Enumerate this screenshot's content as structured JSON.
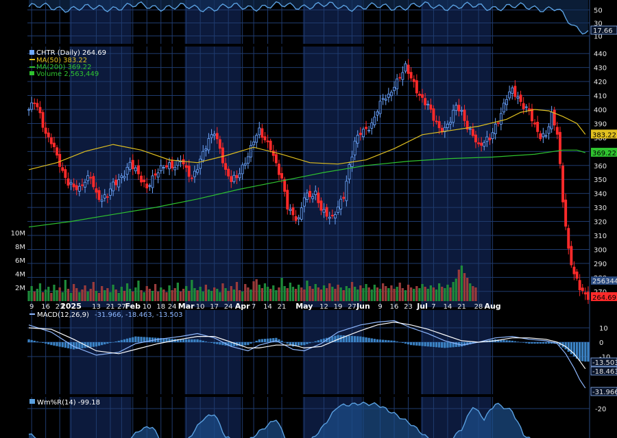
{
  "chart_data": {
    "type": "candlestick",
    "symbol": "CHTR",
    "timeframe": "Daily",
    "colors": {
      "up": "#6fa8ff",
      "down": "#ff2a2a",
      "ma50": "#e0c020",
      "ma200": "#2fc32f",
      "vol_up": "#1e8a3a",
      "vol_down": "#9a3b3b",
      "macd": "#8fb8ff",
      "signal": "#ffffff",
      "hist": "#3b82c4",
      "willr": "#5aa0e0",
      "grid": "#1f3b6e",
      "band": "#0c1a3c"
    },
    "legend": {
      "price": "CHTR (Daily) 264.69",
      "ma50": "MA(50) 383.22",
      "ma200": "MA(200) 369.22",
      "volume": "Volume 2,563,449",
      "macd_label": "MACD(12,26,9)",
      "macd_values": "-31.966, -18.463, -13.503",
      "willr": "Wm%R(14) -99.18"
    },
    "price_axis": {
      "ticks": [
        "440",
        "430",
        "420",
        "410",
        "400",
        "390",
        "380",
        "370",
        "360",
        "350",
        "340",
        "330",
        "320",
        "310",
        "300",
        "290",
        "280",
        "270"
      ],
      "ylim": [
        265,
        445
      ],
      "tags": [
        {
          "text": "383.22",
          "value": 382.2,
          "color": "#e0c020"
        },
        {
          "text": "369.22",
          "value": 369.2,
          "color": "#2fc32f"
        },
        {
          "text": "264.69",
          "value": 266.0,
          "color": "#ff2a2a"
        }
      ]
    },
    "volume_axis": {
      "ticks": [
        "10M",
        "8M",
        "6M",
        "4M",
        "2M"
      ],
      "tag": "2563449",
      "ylim": [
        0,
        11
      ]
    },
    "macd_axis": {
      "ticks": [
        "10",
        "0",
        "-10"
      ],
      "tags": [
        "-13.503",
        "-18.463",
        "-31.966"
      ],
      "ylim": [
        -36,
        18
      ]
    },
    "top_axis": {
      "ticks": [
        "50",
        "30",
        "10"
      ],
      "tag": "17.66"
    },
    "willr_axis": {
      "ticks": [
        "-20"
      ]
    },
    "x_labels": [
      {
        "text": "9",
        "i": 1
      },
      {
        "text": "16",
        "i": 6
      },
      {
        "text": "23",
        "i": 11
      },
      {
        "text": "2025",
        "i": 15,
        "bold": true
      },
      {
        "text": "13",
        "i": 24
      },
      {
        "text": "21",
        "i": 29
      },
      {
        "text": "27",
        "i": 33
      },
      {
        "text": "Feb",
        "i": 37,
        "bold": true
      },
      {
        "text": "10",
        "i": 42
      },
      {
        "text": "18",
        "i": 47
      },
      {
        "text": "24",
        "i": 51
      },
      {
        "text": "Mar",
        "i": 56,
        "bold": true
      },
      {
        "text": "10",
        "i": 61
      },
      {
        "text": "17",
        "i": 66
      },
      {
        "text": "24",
        "i": 71
      },
      {
        "text": "Apr",
        "i": 76,
        "bold": true
      },
      {
        "text": "7",
        "i": 80
      },
      {
        "text": "14",
        "i": 85
      },
      {
        "text": "21",
        "i": 90
      },
      {
        "text": "May",
        "i": 98,
        "bold": true
      },
      {
        "text": "12",
        "i": 105
      },
      {
        "text": "19",
        "i": 110
      },
      {
        "text": "27",
        "i": 115
      },
      {
        "text": "Jun",
        "i": 119,
        "bold": true
      },
      {
        "text": "9",
        "i": 125
      },
      {
        "text": "16",
        "i": 130
      },
      {
        "text": "23",
        "i": 135
      },
      {
        "text": "Jul",
        "i": 140,
        "bold": true
      },
      {
        "text": "7",
        "i": 144
      },
      {
        "text": "14",
        "i": 149
      },
      {
        "text": "21",
        "i": 154
      },
      {
        "text": "28",
        "i": 160
      },
      {
        "text": "Aug",
        "i": 165,
        "bold": true
      }
    ],
    "price_points": [
      [
        0,
        400
      ],
      [
        2,
        405
      ],
      [
        4,
        396
      ],
      [
        6,
        383
      ],
      [
        8,
        378
      ],
      [
        10,
        366
      ],
      [
        12,
        354
      ],
      [
        14,
        348
      ],
      [
        16,
        346
      ],
      [
        18,
        343
      ],
      [
        20,
        348
      ],
      [
        22,
        352
      ],
      [
        24,
        340
      ],
      [
        26,
        336
      ],
      [
        28,
        338
      ],
      [
        30,
        346
      ],
      [
        32,
        350
      ],
      [
        34,
        355
      ],
      [
        36,
        361
      ],
      [
        38,
        356
      ],
      [
        40,
        350
      ],
      [
        42,
        345
      ],
      [
        44,
        351
      ],
      [
        46,
        355
      ],
      [
        48,
        359
      ],
      [
        50,
        361
      ],
      [
        52,
        360
      ],
      [
        54,
        364
      ],
      [
        56,
        356
      ],
      [
        58,
        351
      ],
      [
        60,
        360
      ],
      [
        62,
        369
      ],
      [
        64,
        377
      ],
      [
        66,
        384
      ],
      [
        67,
        378
      ],
      [
        68,
        373
      ],
      [
        70,
        356
      ],
      [
        72,
        349
      ],
      [
        74,
        351
      ],
      [
        76,
        359
      ],
      [
        78,
        368
      ],
      [
        80,
        378
      ],
      [
        82,
        384
      ],
      [
        84,
        378
      ],
      [
        86,
        374
      ],
      [
        88,
        361
      ],
      [
        90,
        349
      ],
      [
        92,
        330
      ],
      [
        94,
        325
      ],
      [
        96,
        322
      ],
      [
        98,
        338
      ],
      [
        100,
        337
      ],
      [
        102,
        340
      ],
      [
        104,
        330
      ],
      [
        106,
        325
      ],
      [
        108,
        321
      ],
      [
        110,
        330
      ],
      [
        112,
        339
      ],
      [
        114,
        360
      ],
      [
        116,
        376
      ],
      [
        118,
        383
      ],
      [
        120,
        386
      ],
      [
        122,
        390
      ],
      [
        124,
        400
      ],
      [
        126,
        407
      ],
      [
        128,
        409
      ],
      [
        130,
        418
      ],
      [
        132,
        424
      ],
      [
        134,
        430
      ],
      [
        136,
        422
      ],
      [
        138,
        414
      ],
      [
        140,
        408
      ],
      [
        142,
        403
      ],
      [
        144,
        393
      ],
      [
        146,
        386
      ],
      [
        148,
        387
      ],
      [
        150,
        393
      ],
      [
        152,
        402
      ],
      [
        154,
        397
      ],
      [
        156,
        388
      ],
      [
        158,
        383
      ],
      [
        160,
        373
      ],
      [
        162,
        376
      ],
      [
        164,
        380
      ],
      [
        166,
        389
      ],
      [
        168,
        397
      ],
      [
        170,
        408
      ],
      [
        172,
        414
      ],
      [
        174,
        409
      ],
      [
        176,
        403
      ],
      [
        178,
        398
      ],
      [
        180,
        387
      ],
      [
        182,
        381
      ],
      [
        184,
        383
      ],
      [
        186,
        396
      ],
      [
        188,
        382
      ],
      [
        190,
        335
      ],
      [
        192,
        300
      ],
      [
        194,
        283
      ],
      [
        196,
        272
      ],
      [
        198,
        266
      ]
    ],
    "ma50": [
      [
        0,
        357
      ],
      [
        10,
        362
      ],
      [
        20,
        370
      ],
      [
        30,
        375
      ],
      [
        40,
        371
      ],
      [
        50,
        364
      ],
      [
        60,
        362
      ],
      [
        70,
        367
      ],
      [
        80,
        373
      ],
      [
        90,
        368
      ],
      [
        100,
        362
      ],
      [
        110,
        361
      ],
      [
        120,
        364
      ],
      [
        130,
        372
      ],
      [
        140,
        382
      ],
      [
        150,
        385
      ],
      [
        160,
        388
      ],
      [
        170,
        393
      ],
      [
        175,
        398
      ],
      [
        180,
        400
      ],
      [
        185,
        399
      ],
      [
        190,
        395
      ],
      [
        195,
        390
      ],
      [
        198,
        382.2
      ]
    ],
    "ma200": [
      [
        0,
        316
      ],
      [
        15,
        320
      ],
      [
        30,
        325
      ],
      [
        45,
        330
      ],
      [
        60,
        336
      ],
      [
        75,
        343
      ],
      [
        90,
        349
      ],
      [
        105,
        355
      ],
      [
        120,
        360
      ],
      [
        135,
        363
      ],
      [
        150,
        365
      ],
      [
        165,
        366
      ],
      [
        180,
        368
      ],
      [
        190,
        371
      ],
      [
        195,
        371
      ],
      [
        198,
        369.2
      ]
    ],
    "volume": [
      1.5,
      2.2,
      1.4,
      1.8,
      2.6,
      1.3,
      1.7,
      2.1,
      1.2,
      2.4,
      1.6,
      2.0,
      1.3,
      3.1,
      1.8,
      1.2,
      2.5,
      1.9,
      1.3,
      1.7,
      2.3,
      1.4,
      1.8,
      2.8,
      1.5,
      1.2,
      2.2,
      1.6,
      1.9,
      1.3,
      2.4,
      1.7,
      1.2,
      2.1,
      1.5,
      2.6,
      1.8,
      1.4,
      2.0,
      3.0,
      1.6,
      1.3,
      2.2,
      1.8,
      1.5,
      2.5,
      1.4,
      2.0,
      1.7,
      1.3,
      2.3,
      1.6,
      1.9,
      2.7,
      1.4,
      1.8,
      2.2,
      1.5,
      3.1,
      1.9,
      1.6,
      2.1,
      1.4,
      2.4,
      1.7,
      1.5,
      2.0,
      1.8,
      1.3,
      2.6,
      1.9,
      1.5,
      2.2,
      1.7,
      2.8,
      1.6,
      1.4,
      2.5,
      2.0,
      1.7,
      2.9,
      3.2,
      2.4,
      1.9,
      2.6,
      2.1,
      1.8,
      2.3,
      1.6,
      2.0,
      3.4,
      2.2,
      1.9,
      2.7,
      2.1,
      1.8,
      2.4,
      2.0,
      1.7,
      3.0,
      2.2,
      1.8,
      2.5,
      2.0,
      1.7,
      2.3,
      1.9,
      2.6,
      2.1,
      1.8,
      2.4,
      2.0,
      1.6,
      2.2,
      1.9,
      2.8,
      2.1,
      1.7,
      2.3,
      1.9,
      2.5,
      2.0,
      1.7,
      2.4,
      2.0,
      1.8,
      2.6,
      2.2,
      1.9,
      2.3,
      1.8,
      2.1,
      2.7,
      1.9,
      1.6,
      2.4,
      2.0,
      1.8,
      2.2,
      1.9,
      2.5,
      2.1,
      1.8,
      2.3,
      2.0,
      1.7,
      2.6,
      2.1,
      1.9,
      2.4,
      2.0,
      2.8,
      3.3,
      4.6,
      5.2,
      4.1,
      3.4,
      2.6,
      2.2,
      2.0
    ],
    "macd": [
      [
        0,
        12
      ],
      [
        8,
        7
      ],
      [
        16,
        -3
      ],
      [
        24,
        -9
      ],
      [
        32,
        -7
      ],
      [
        38,
        -1
      ],
      [
        46,
        2
      ],
      [
        54,
        4
      ],
      [
        60,
        6
      ],
      [
        66,
        3
      ],
      [
        72,
        -3
      ],
      [
        78,
        -6
      ],
      [
        82,
        -2
      ],
      [
        88,
        1
      ],
      [
        94,
        -5
      ],
      [
        98,
        -6
      ],
      [
        104,
        -1
      ],
      [
        110,
        7
      ],
      [
        118,
        12
      ],
      [
        124,
        14
      ],
      [
        130,
        15
      ],
      [
        136,
        10
      ],
      [
        142,
        6
      ],
      [
        148,
        1
      ],
      [
        154,
        -2
      ],
      [
        160,
        0
      ],
      [
        166,
        3
      ],
      [
        172,
        4
      ],
      [
        178,
        2
      ],
      [
        184,
        1
      ],
      [
        188,
        -1
      ],
      [
        191,
        -8
      ],
      [
        194,
        -18
      ],
      [
        196,
        -26
      ],
      [
        198,
        -31.966
      ]
    ],
    "signal": [
      [
        0,
        10
      ],
      [
        8,
        9
      ],
      [
        16,
        2
      ],
      [
        24,
        -6
      ],
      [
        32,
        -8
      ],
      [
        38,
        -5
      ],
      [
        46,
        -1
      ],
      [
        54,
        2
      ],
      [
        60,
        4
      ],
      [
        66,
        4
      ],
      [
        72,
        0
      ],
      [
        78,
        -4
      ],
      [
        82,
        -4
      ],
      [
        88,
        -2
      ],
      [
        94,
        -2
      ],
      [
        98,
        -4
      ],
      [
        104,
        -3
      ],
      [
        110,
        2
      ],
      [
        118,
        8
      ],
      [
        124,
        12
      ],
      [
        130,
        14
      ],
      [
        136,
        12
      ],
      [
        142,
        9
      ],
      [
        148,
        5
      ],
      [
        154,
        1
      ],
      [
        160,
        0
      ],
      [
        166,
        1
      ],
      [
        172,
        3
      ],
      [
        178,
        3
      ],
      [
        184,
        2
      ],
      [
        188,
        0
      ],
      [
        191,
        -3
      ],
      [
        194,
        -8
      ],
      [
        196,
        -13
      ],
      [
        198,
        -18.463
      ]
    ],
    "willr": [
      [
        0,
        -70
      ],
      [
        8,
        -90
      ],
      [
        16,
        -95
      ],
      [
        24,
        -98
      ],
      [
        32,
        -96
      ],
      [
        40,
        -60
      ],
      [
        44,
        -55
      ],
      [
        48,
        -95
      ],
      [
        56,
        -85
      ],
      [
        62,
        -40
      ],
      [
        66,
        -30
      ],
      [
        70,
        -75
      ],
      [
        76,
        -92
      ],
      [
        82,
        -65
      ],
      [
        88,
        -40
      ],
      [
        92,
        -85
      ],
      [
        98,
        -96
      ],
      [
        104,
        -60
      ],
      [
        110,
        -15
      ],
      [
        118,
        -10
      ],
      [
        124,
        -12
      ],
      [
        130,
        -30
      ],
      [
        136,
        -50
      ],
      [
        142,
        -78
      ],
      [
        148,
        -92
      ],
      [
        154,
        -60
      ],
      [
        158,
        -15
      ],
      [
        162,
        -40
      ],
      [
        166,
        -10
      ],
      [
        172,
        -25
      ],
      [
        176,
        -70
      ],
      [
        182,
        -95
      ],
      [
        188,
        -85
      ],
      [
        192,
        -98
      ],
      [
        198,
        -99.18
      ]
    ],
    "top_indicator": [
      [
        0,
        55
      ],
      [
        20,
        52
      ],
      [
        40,
        56
      ],
      [
        60,
        53
      ],
      [
        80,
        55
      ],
      [
        100,
        57
      ],
      [
        120,
        54
      ],
      [
        140,
        56
      ],
      [
        160,
        55
      ],
      [
        180,
        54
      ],
      [
        188,
        52
      ],
      [
        191,
        35
      ],
      [
        194,
        22
      ],
      [
        198,
        17.66
      ]
    ]
  }
}
